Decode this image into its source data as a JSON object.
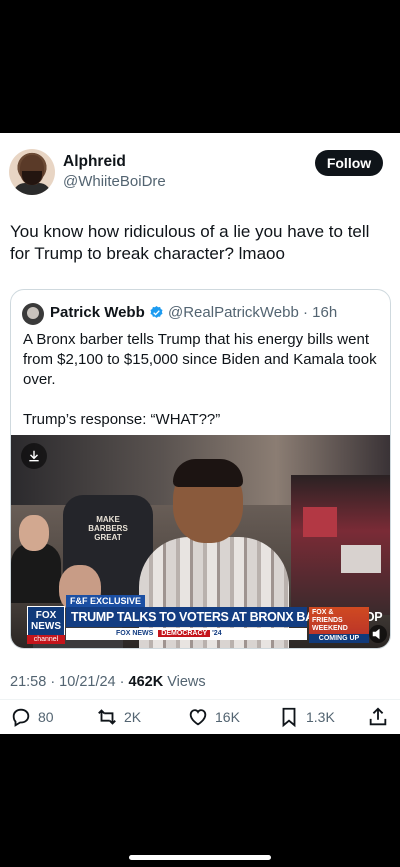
{
  "author": {
    "display_name": "Alphreid",
    "handle": "@WhiiteBoiDre",
    "follow_label": "Follow"
  },
  "tweet": {
    "text": "You know how ridiculous of a lie you have to tell for Trump to break character? lmaoo",
    "timestamp": "21:58 · 10/21/24 · ",
    "views_count": "462K",
    "views_label": " Views"
  },
  "quoted": {
    "display_name": "Patrick Webb",
    "meta": "@RealPatrickWebb · 16h",
    "paragraph1": "A Bronx barber tells Trump that his energy bills went from $2,100 to $15,000 since Biden and Kamala took over.",
    "paragraph2": "Trump’s response: “WHAT??”"
  },
  "video": {
    "shirt_text": "MAKE BARBERS GREAT",
    "fox_tag": "F&F EXCLUSIVE",
    "fox_logo": "FOX NEWS",
    "fox_channel": "channel",
    "headline": "TRUMP TALKS TO VOTERS AT BRONX BARBERSHOP",
    "ticker_brand": "FOX NEWS",
    "ticker_demo": "DEMOCRACY",
    "ticker_year": "'24",
    "side_brand": "FOX & FRIENDS",
    "side_sub": "WEEKEND",
    "coming_up": "COMING UP"
  },
  "actions": {
    "replies": "80",
    "reposts": "2K",
    "likes": "16K",
    "bookmarks": "1.3K"
  },
  "colors": {
    "primary_text": "#0f1419",
    "secondary_text": "#536471",
    "verified": "#1d9bf0",
    "fox_blue": "#133d82",
    "fox_red": "#c4151c"
  }
}
